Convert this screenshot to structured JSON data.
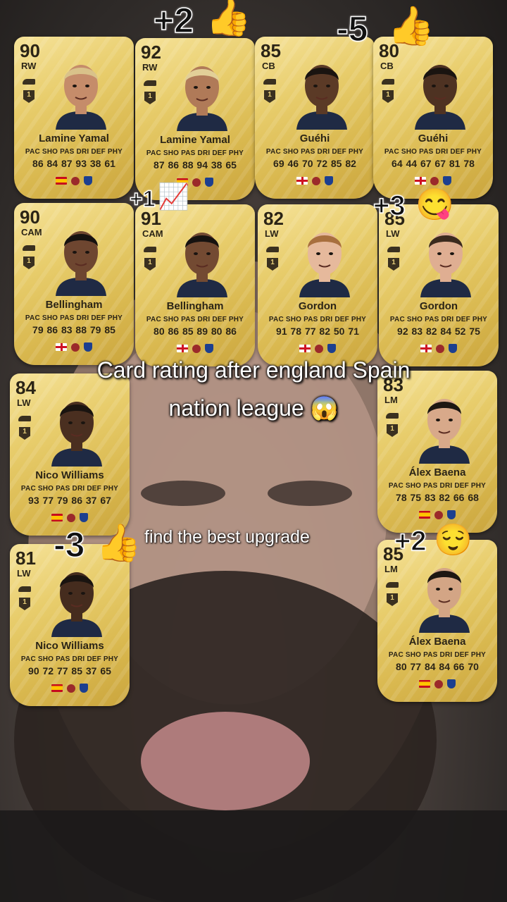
{
  "caption": {
    "line1": "Card rating after england Spain",
    "line2": "nation league 😱"
  },
  "subcaption": "find the best upgrade",
  "stat_labels": "PAC SHO PAS DRI DEF PHY",
  "deltas": [
    {
      "text": "+2",
      "emoji": "👍"
    },
    {
      "text": "-5",
      "emoji": "👍"
    },
    {
      "text": "+1",
      "emoji": "📈"
    },
    {
      "text": "+3",
      "emoji": "😋"
    },
    {
      "text": "-3",
      "emoji": "👍"
    },
    {
      "text": "+2",
      "emoji": "😌"
    }
  ],
  "cards": [
    {
      "rating": "90",
      "position": "RW",
      "name": "Lamine Yamal",
      "stats": "86 84 87 93 38 61",
      "nation": "spain",
      "skin": "#c58c6a",
      "hair": "#d9c28a"
    },
    {
      "rating": "92",
      "position": "RW",
      "name": "Lamine Yamal",
      "stats": "87 86 88 94 38 65",
      "nation": "spain",
      "skin": "#b07a58",
      "hair": "#e2cf98"
    },
    {
      "rating": "85",
      "position": "CB",
      "name": "Guéhi",
      "stats": "69 46 70 72 85 82",
      "nation": "england",
      "skin": "#5b3a26",
      "hair": "#1a1410"
    },
    {
      "rating": "80",
      "position": "CB",
      "name": "Guéhi",
      "stats": "64 44 67 67 81 78",
      "nation": "england",
      "skin": "#4e3222",
      "hair": "#1a1410"
    },
    {
      "rating": "90",
      "position": "CAM",
      "name": "Bellingham",
      "stats": "79 86 83 88 79 85",
      "nation": "england",
      "skin": "#6e4630",
      "hair": "#161210"
    },
    {
      "rating": "91",
      "position": "CAM",
      "name": "Bellingham",
      "stats": "80 86 85 89 80 86",
      "nation": "england",
      "skin": "#734a32",
      "hair": "#161210"
    },
    {
      "rating": "82",
      "position": "LW",
      "name": "Gordon",
      "stats": "91 78 77 82 50 71",
      "nation": "england",
      "skin": "#e6b99c",
      "hair": "#a86f3e"
    },
    {
      "rating": "85",
      "position": "LW",
      "name": "Gordon",
      "stats": "92 83 82 84 52 75",
      "nation": "england",
      "skin": "#dfae92",
      "hair": "#3b2a1e"
    },
    {
      "rating": "84",
      "position": "LW",
      "name": "Nico Williams",
      "stats": "93 77 79 86 37 67",
      "nation": "spain",
      "skin": "#4a2f20",
      "hair": "#1a1410"
    },
    {
      "rating": "83",
      "position": "LM",
      "name": "Álex Baena",
      "stats": "78 75 83 82 66 68",
      "nation": "spain",
      "skin": "#d8a98a",
      "hair": "#1d1712"
    },
    {
      "rating": "81",
      "position": "LW",
      "name": "Nico Williams",
      "stats": "90 72 77 85 37 65",
      "nation": "spain",
      "skin": "#452c1e",
      "hair": "#1a1410"
    },
    {
      "rating": "85",
      "position": "LM",
      "name": "Álex Baena",
      "stats": "80 77 84 84 66 70",
      "nation": "spain",
      "skin": "#d3a585",
      "hair": "#1d1712"
    }
  ]
}
